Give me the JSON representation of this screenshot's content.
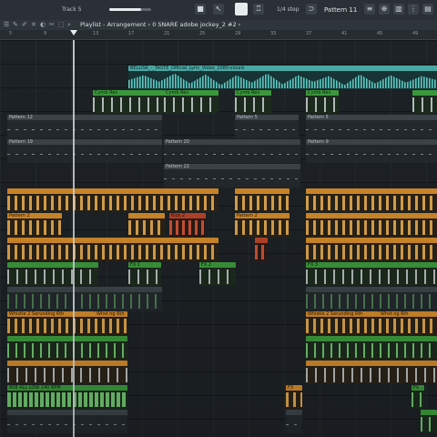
{
  "toolbar": {
    "track_label": "Track 5",
    "snap_label": "1/4 step",
    "pattern_label": "Pattern 11",
    "master_level": 0.75,
    "icons": [
      "menu-icon",
      "arrow-icon",
      "sliders-icon",
      "wave-icon",
      "stamp-icon",
      "metronome-icon",
      "camera-icon",
      "magnet-icon",
      "play-icon",
      "plug-icon",
      "mixer-icon",
      "piano-icon",
      "browser-icon"
    ]
  },
  "playlist": {
    "title": "Playlist - Arrangement › 0 SNARE adobe jockey_2 #2 ›",
    "ruler_ticks": [
      "5",
      "9",
      "13",
      "17",
      "21",
      "25",
      "29",
      "33",
      "37",
      "41",
      "45",
      "49"
    ]
  },
  "clips": {
    "vocal_audio": "BELLISK_-_TASTE_Official_Lyric_Video_1080-vocals",
    "cymb_rev_1": "Cymb Rev",
    "cymb_rev_2": "Cymb Rev",
    "cymb_rev_3": "Cymb Rev",
    "cymb_rev_4": "Cymb Rev",
    "pattern_a1": "Pattern 12",
    "pattern_a2": "Pattern 5",
    "pattern_a3": "Pattern 5",
    "pattern_b1": "Pattern 19",
    "pattern_b2": "Pattern 20",
    "pattern_b3": "Pattern 9",
    "pattern_c1": "Pattern 22",
    "orange_1": "Pattern 2",
    "orange_2": "Pattern 2",
    "red_1": "Kick 2",
    "green_1": "FX 1",
    "green_2": "FX 2",
    "green_3": "FX 3",
    "orange_long_1": "Whistle 2 Serunding 6th",
    "orange_long_2": "Whst ng 6th",
    "orange_long_3": "Whistle 2 Serunding 6th",
    "orange_long_4": "Whst ng 6th",
    "green_long_1": "808 ALL LOW 140 BPM",
    "green_short_1": "FX",
    "green_short_2": "FX"
  },
  "colors": {
    "audio": "#4aa9a6",
    "pattern_green": "#3c9a3c",
    "pattern_orange": "#d48b2a",
    "pattern_red": "#b9452a",
    "pattern_grey": "#3d454a"
  }
}
